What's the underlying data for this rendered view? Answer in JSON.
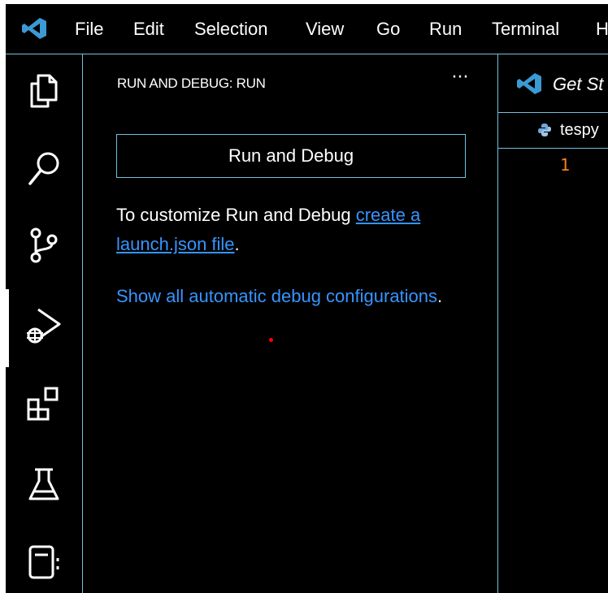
{
  "menubar": {
    "logo_icon": "vscode-logo-icon",
    "items": [
      "File",
      "Edit",
      "Selection",
      "View",
      "Go",
      "Run",
      "Terminal",
      "H"
    ]
  },
  "activitybar": {
    "icons": [
      "explorer-icon",
      "search-icon",
      "source-control-icon",
      "run-debug-icon",
      "extensions-icon",
      "testing-icon",
      "notebook-icon"
    ],
    "active": "run-debug-icon"
  },
  "sidebar": {
    "title": "RUN AND DEBUG: RUN",
    "more_actions": "···",
    "run_button": "Run and Debug",
    "customize_text": "To customize Run and Debug ",
    "launch_link": "create a launch.json file",
    "period": ".",
    "show_link": "Show all automatic debug configurations",
    "period2": "."
  },
  "editor": {
    "tab_label": "Get St",
    "breadcrumb": "tespy",
    "line_number": "1"
  },
  "colors": {
    "background": "#000000",
    "border": "#6fc3df",
    "link": "#3794ff",
    "line_number": "#f38518",
    "logo": "#3c99d4"
  }
}
